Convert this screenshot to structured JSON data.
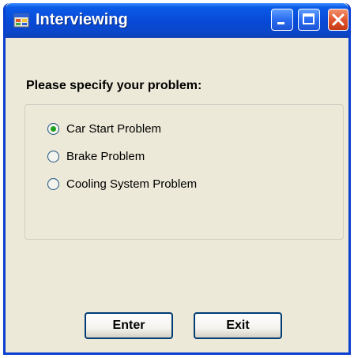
{
  "window": {
    "title": "Interviewing",
    "app_icon": "form-icon"
  },
  "titlebar_buttons": {
    "minimize_icon": "minimize-icon",
    "maximize_icon": "maximize-icon",
    "close_icon": "close-icon"
  },
  "form": {
    "prompt": "Please specify your problem:",
    "options": [
      {
        "label": "Car Start Problem",
        "selected": true
      },
      {
        "label": "Brake Problem",
        "selected": false
      },
      {
        "label": "Cooling System Problem",
        "selected": false
      }
    ],
    "enter_label": "Enter",
    "exit_label": "Exit"
  },
  "colors": {
    "titlebar": "#0a5be8",
    "window_bg": "#ece9d8",
    "radio_selected": "#21a121"
  }
}
